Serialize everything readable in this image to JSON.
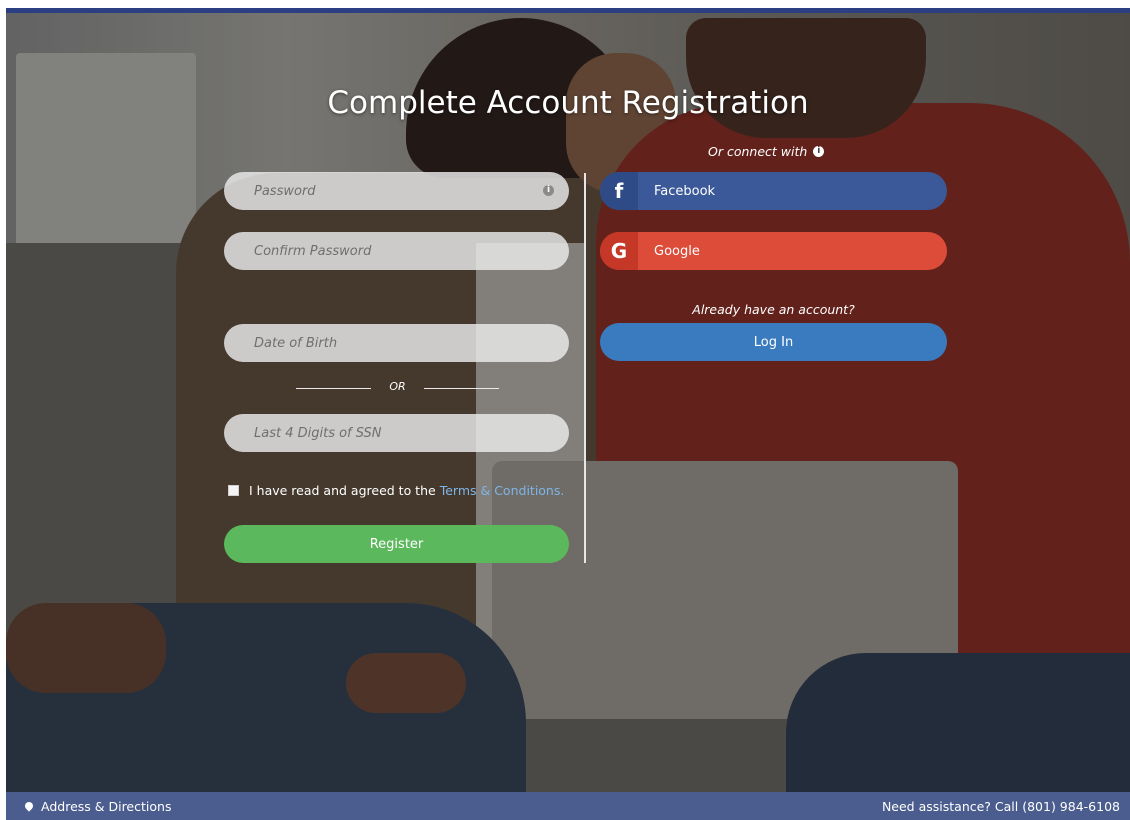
{
  "page": {
    "title": "Complete Account Registration"
  },
  "form": {
    "password_placeholder": "Password",
    "confirm_password_placeholder": "Confirm Password",
    "dob_placeholder": "Date of Birth",
    "or_text": "OR",
    "ssn_placeholder": "Last 4 Digits of SSN",
    "terms_text": "I have read and agreed to the",
    "terms_link": "Terms & Conditions.",
    "terms_checked": false,
    "register_label": "Register"
  },
  "social": {
    "connect_label": "Or connect with",
    "facebook_label": "Facebook",
    "facebook_icon": "f",
    "google_label": "Google",
    "google_icon": "G",
    "already_text": "Already have an account?",
    "login_label": "Log In"
  },
  "footer": {
    "address_label": "Address & Directions",
    "assistance_text": "Need assistance? Call (801) 984-6108"
  },
  "colors": {
    "register": "#5cb85c",
    "facebook": "#3b5998",
    "google": "#dd4b39",
    "login": "#3a7bbf",
    "footer": "#4a5d8e",
    "link": "#7fb5e6"
  }
}
